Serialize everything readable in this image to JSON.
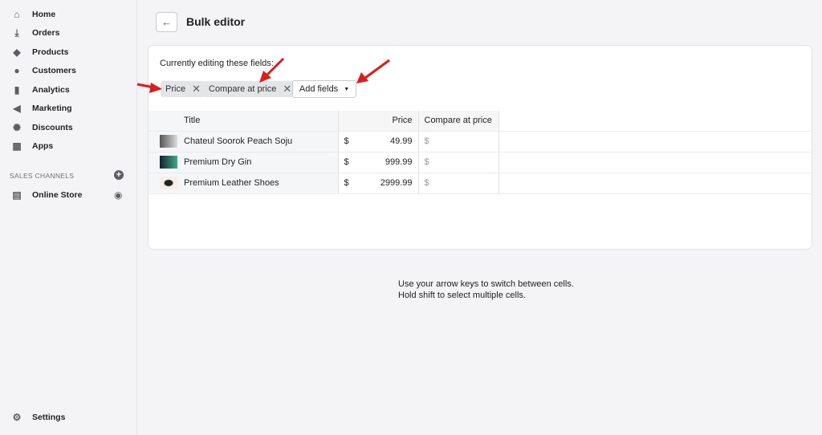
{
  "sidebar": {
    "items": [
      {
        "label": "Home",
        "icon": "home-icon"
      },
      {
        "label": "Orders",
        "icon": "orders-icon"
      },
      {
        "label": "Products",
        "icon": "tag-icon"
      },
      {
        "label": "Customers",
        "icon": "person-icon"
      },
      {
        "label": "Analytics",
        "icon": "bar-chart-icon"
      },
      {
        "label": "Marketing",
        "icon": "megaphone-icon"
      },
      {
        "label": "Discounts",
        "icon": "discount-icon"
      },
      {
        "label": "Apps",
        "icon": "apps-icon"
      }
    ],
    "sales_channels": "SALES CHANNELS",
    "online_store": "Online Store",
    "settings": "Settings"
  },
  "header": {
    "title": "Bulk editor"
  },
  "editor": {
    "label": "Currently editing these fields:",
    "fields": [
      "Price",
      "Compare at price"
    ],
    "add_fields": "Add fields",
    "columns": [
      "Title",
      "Price",
      "Compare at price"
    ],
    "rows": [
      {
        "title": "Chateul Soorok Peach Soju",
        "currency": "$",
        "price": "49.99",
        "compare": "$"
      },
      {
        "title": "Premium Dry Gin",
        "currency": "$",
        "price": "999.99",
        "compare": "$"
      },
      {
        "title": "Premium Leather Shoes",
        "currency": "$",
        "price": "2999.99",
        "compare": "$"
      }
    ]
  },
  "help": {
    "line1": "Use your arrow keys to switch between cells.",
    "line2": "Hold shift to select multiple cells."
  },
  "colors": {
    "annotation_arrow": "#e01b1b"
  }
}
